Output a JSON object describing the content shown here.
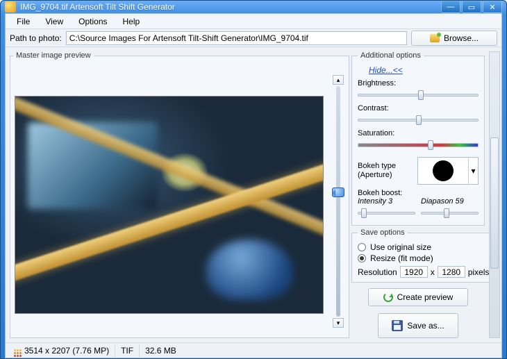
{
  "window": {
    "title": "IMG_9704.tif Artensoft Tilt Shift Generator"
  },
  "menu": {
    "file": "File",
    "view": "View",
    "options": "Options",
    "help": "Help"
  },
  "path": {
    "label": "Path to photo:",
    "value": "C:\\Source Images For Artensoft Tilt-Shift Generator\\IMG_9704.tif",
    "browse": "Browse..."
  },
  "master_legend": "Master image preview",
  "additional": {
    "legend": "Additional options",
    "hide": "Hide...<<",
    "brightness": "Brightness:",
    "contrast": "Contrast:",
    "saturation": "Saturation:",
    "bokeh_type": "Bokeh type (Aperture)",
    "bokeh_boost": "Bokeh boost:",
    "intensity": "Intensity 3",
    "diapason": "Diapason 59"
  },
  "save": {
    "legend": "Save options",
    "use_original": "Use original size",
    "resize_fit": "Resize (fit mode)",
    "resolution": "Resolution",
    "width": "1920",
    "x": "x",
    "height": "1280",
    "pixels": "pixels",
    "create_preview": "Create preview",
    "save_as": "Save as..."
  },
  "status": {
    "dims": "3514 x 2207 (7.76 MP)",
    "format": "TIF",
    "size": "32.6 MB"
  }
}
